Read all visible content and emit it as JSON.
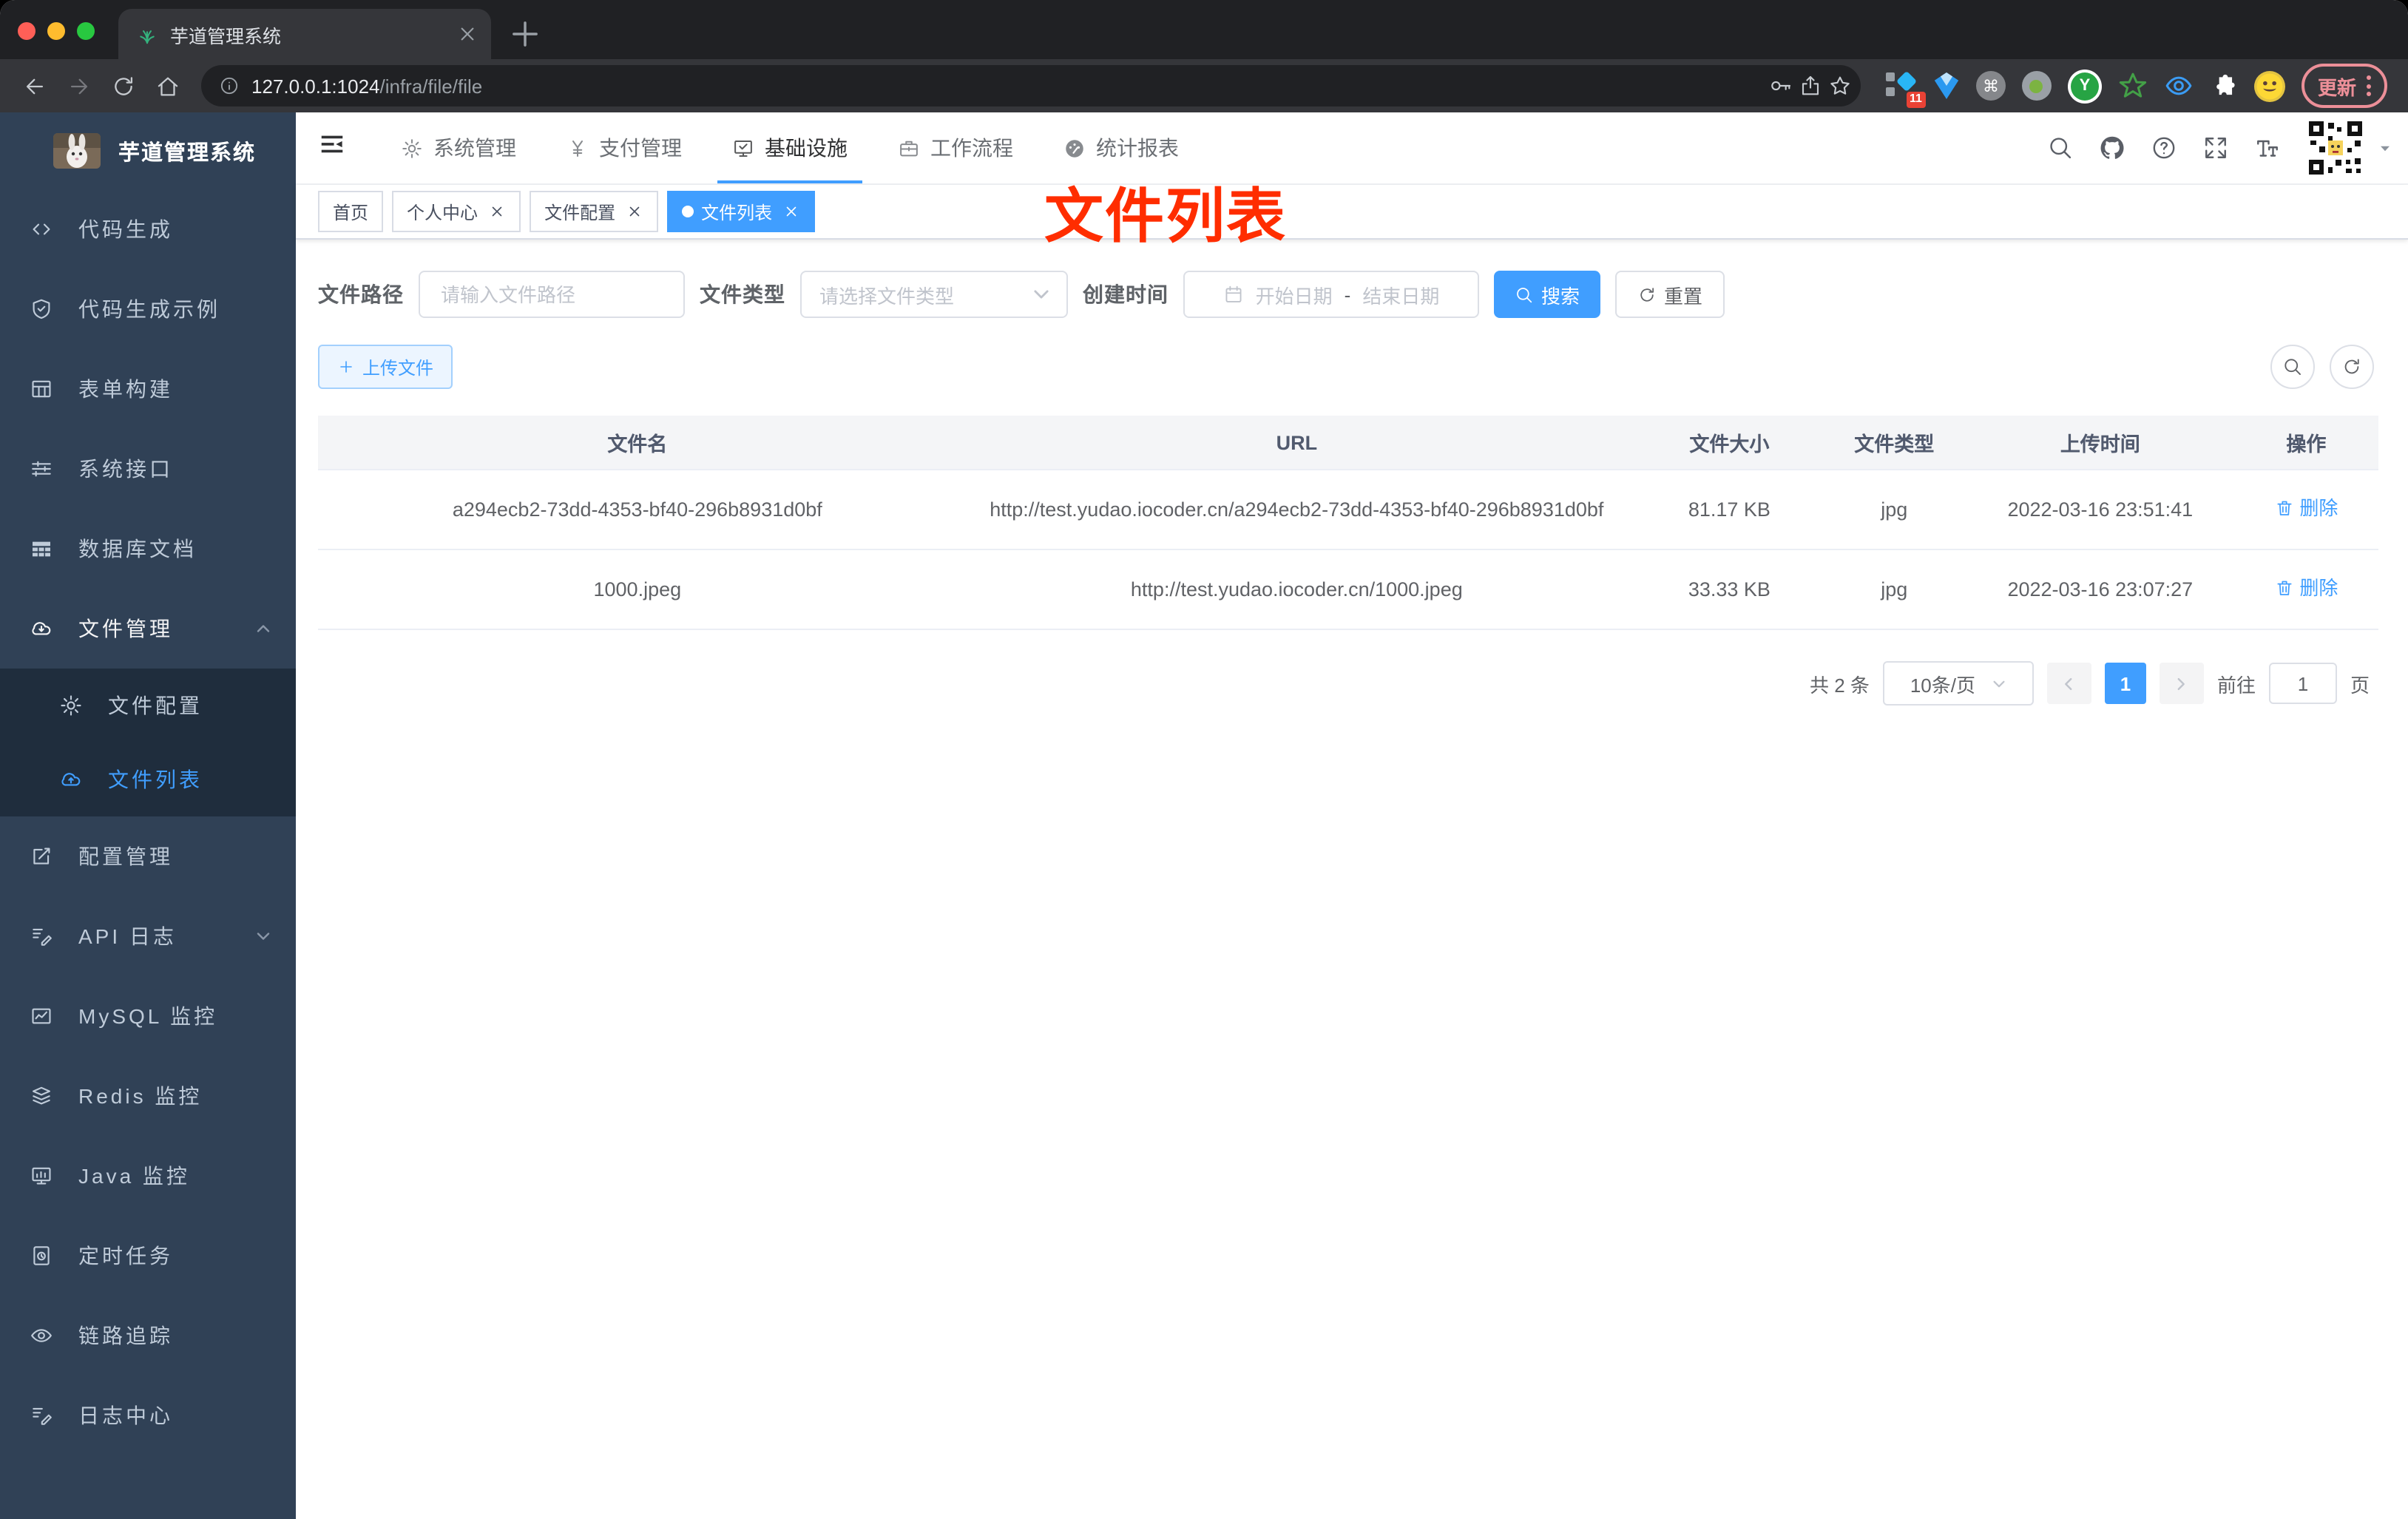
{
  "colors": {
    "primary": "#409eff",
    "sidebar_bg": "#304156",
    "submenu_bg": "#1f2d3d",
    "annotation_red": "#ff2d00",
    "tag_active": "#409eff"
  },
  "browser": {
    "tab": {
      "title": "芋道管理系统"
    },
    "url": {
      "host": "127.0.0.1:1024",
      "path": "/infra/file/file"
    },
    "extensions": {
      "badge": "11",
      "y_letter": "Y",
      "cmd_glyph": "⌘"
    },
    "update_label": "更新"
  },
  "app": {
    "brand": "芋道管理系统",
    "top_nav": [
      {
        "label": "系统管理",
        "icon": "gear",
        "active": false
      },
      {
        "label": "支付管理",
        "icon": "yen",
        "active": false
      },
      {
        "label": "基础设施",
        "icon": "monitor-check",
        "active": true
      },
      {
        "label": "工作流程",
        "icon": "briefcase",
        "active": false
      },
      {
        "label": "统计报表",
        "icon": "dashboard",
        "active": false
      }
    ],
    "sidebar_menu": [
      {
        "label": "代码生成",
        "icon": "code"
      },
      {
        "label": "代码生成示例",
        "icon": "shield-check"
      },
      {
        "label": "表单构建",
        "icon": "form-grid"
      },
      {
        "label": "系统接口",
        "icon": "sliders"
      },
      {
        "label": "数据库文档",
        "icon": "table-solid"
      },
      {
        "label": "文件管理",
        "icon": "cloud-down",
        "expanded": true,
        "children": [
          {
            "label": "文件配置",
            "icon": "gear",
            "active": false
          },
          {
            "label": "文件列表",
            "icon": "cloud-up",
            "active": true
          }
        ]
      },
      {
        "label": "配置管理",
        "icon": "edit-square"
      },
      {
        "label": "API 日志",
        "icon": "doc-edit",
        "collapsible": true
      },
      {
        "label": "MySQL 监控",
        "icon": "chart-line"
      },
      {
        "label": "Redis 监控",
        "icon": "layers"
      },
      {
        "label": "Java 监控",
        "icon": "java-monitor"
      },
      {
        "label": "定时任务",
        "icon": "doc-clock"
      },
      {
        "label": "链路追踪",
        "icon": "eye"
      },
      {
        "label": "日志中心",
        "icon": "doc-edit"
      }
    ],
    "tags_view": [
      {
        "label": "首页",
        "closable": false,
        "active": false
      },
      {
        "label": "个人中心",
        "closable": true,
        "active": false
      },
      {
        "label": "文件配置",
        "closable": true,
        "active": false
      },
      {
        "label": "文件列表",
        "closable": true,
        "active": true
      }
    ],
    "annotation": "文件列表"
  },
  "page": {
    "filters": {
      "path_label": "文件路径",
      "path_placeholder": "请输入文件路径",
      "type_label": "文件类型",
      "type_placeholder": "请选择文件类型",
      "date_label": "创建时间",
      "date_start": "开始日期",
      "date_separator": "-",
      "date_end": "结束日期",
      "search_label": "搜索",
      "reset_label": "重置"
    },
    "toolbar": {
      "upload_label": "上传文件"
    },
    "table": {
      "columns": [
        "文件名",
        "URL",
        "文件大小",
        "文件类型",
        "上传时间",
        "操作"
      ],
      "rows": [
        {
          "name": "a294ecb2-73dd-4353-bf40-296b8931d0bf",
          "url": "http://test.yudao.iocoder.cn/a294ecb2-73dd-4353-bf40-296b8931d0bf",
          "size": "81.17 KB",
          "type": "jpg",
          "time": "2022-03-16 23:51:41",
          "action": "删除"
        },
        {
          "name": "1000.jpeg",
          "url": "http://test.yudao.iocoder.cn/1000.jpeg",
          "size": "33.33 KB",
          "type": "jpg",
          "time": "2022-03-16 23:07:27",
          "action": "删除"
        }
      ]
    },
    "pagination": {
      "total_text": "共 2 条",
      "page_size_option": "10条/页",
      "current_page": "1",
      "goto_label": "前往",
      "goto_value": "1",
      "unit_label": "页"
    }
  }
}
